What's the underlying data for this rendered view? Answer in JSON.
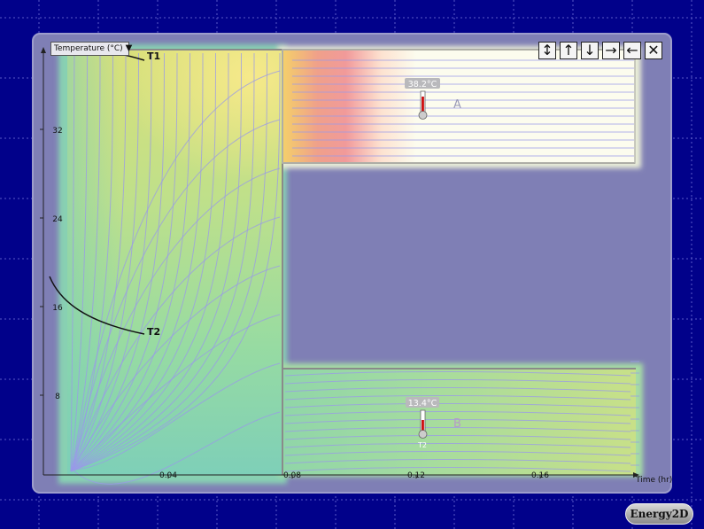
{
  "app": {
    "logo_text": "Energy2D"
  },
  "toolbar": {
    "buttons": [
      {
        "name": "expand-vertical-button",
        "glyph": "↕"
      },
      {
        "name": "move-up-button",
        "glyph": "↑"
      },
      {
        "name": "move-down-button",
        "glyph": "↓"
      },
      {
        "name": "move-right-button",
        "glyph": "→"
      },
      {
        "name": "move-left-button",
        "glyph": "←"
      },
      {
        "name": "close-button",
        "glyph": "✕"
      }
    ]
  },
  "graph": {
    "series_selector": "Temperature (°C)",
    "y_ticks": [
      "32",
      "24",
      "16",
      "8"
    ],
    "x_ticks": [
      "0.04",
      "0.08",
      "0.12",
      "0.16"
    ],
    "x_axis_label": "Time (hr)",
    "curves": [
      {
        "label": "T1"
      },
      {
        "label": "T2"
      }
    ]
  },
  "sensors": [
    {
      "reading": "38.2°C",
      "id_label": ""
    },
    {
      "reading": "13.4°C",
      "id_label": "T2"
    }
  ],
  "regions": [
    {
      "label": "A"
    },
    {
      "label": "B"
    }
  ],
  "colors": {
    "background": "#01018a",
    "panel": "#7f7fb5",
    "hot": "#f0a0a0",
    "warm": "#f4e97a",
    "cool": "#7fd0b4",
    "streamline": "#8e8ee8",
    "pale": "#fcfcee"
  }
}
